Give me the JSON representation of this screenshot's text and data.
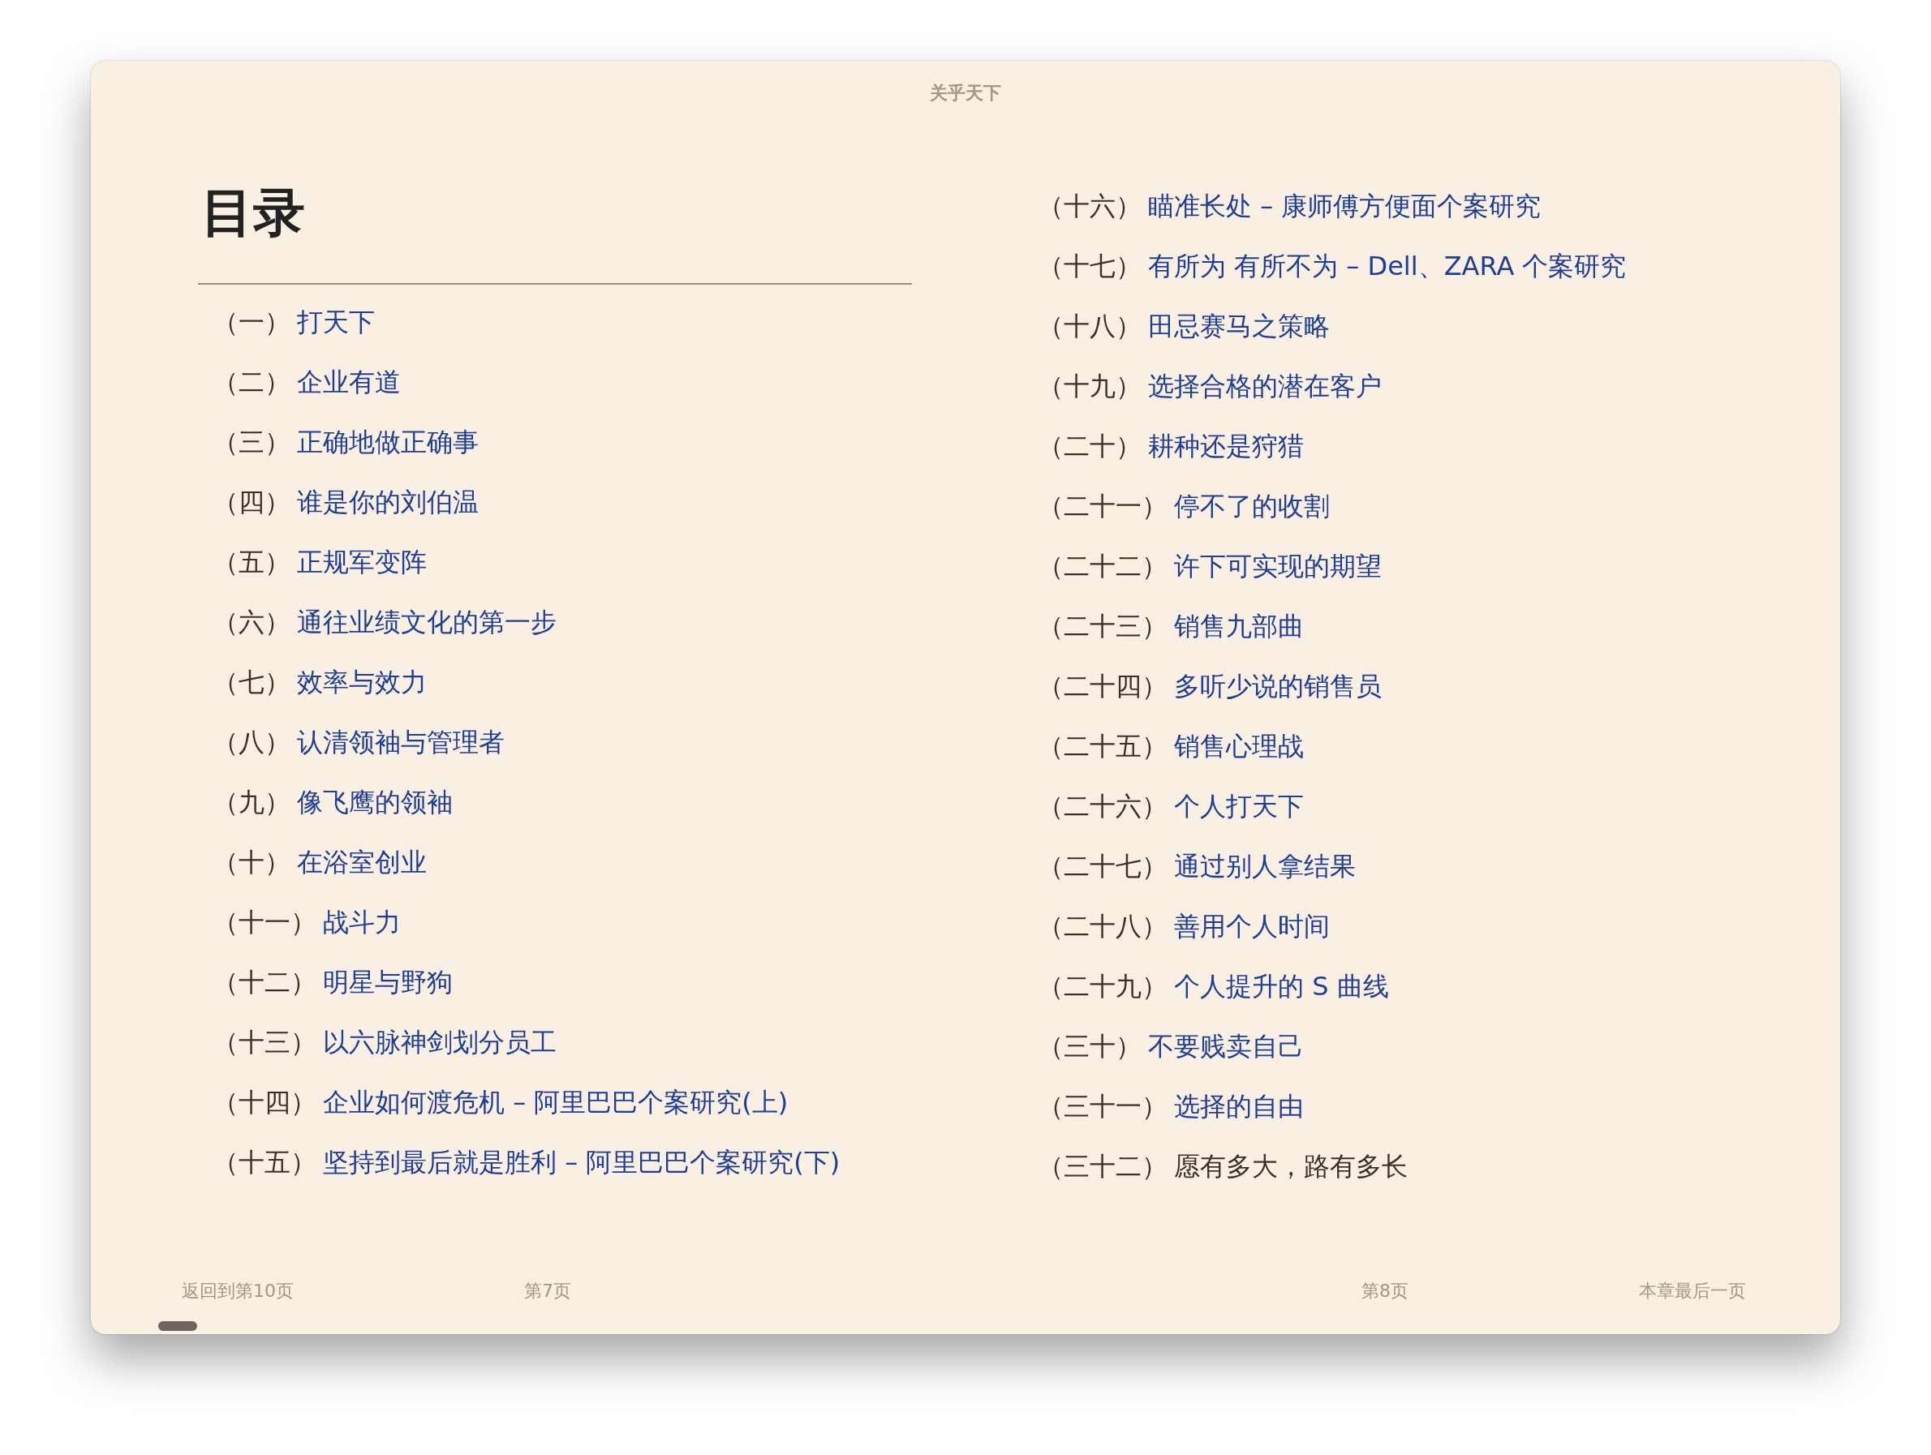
{
  "window": {
    "title": "关乎天下"
  },
  "heading": "目录",
  "columns": [
    {
      "entries": [
        {
          "number": "（一）",
          "title": "打天下",
          "link": true
        },
        {
          "number": "（二）",
          "title": "企业有道",
          "link": true
        },
        {
          "number": "（三）",
          "title": "正确地做正确事",
          "link": true
        },
        {
          "number": "（四）",
          "title": "谁是你的刘伯温",
          "link": true
        },
        {
          "number": "（五）",
          "title": "正规军变阵",
          "link": true
        },
        {
          "number": "（六）",
          "title": "通往业绩文化的第一步",
          "link": true
        },
        {
          "number": "（七）",
          "title": "效率与效力",
          "link": true
        },
        {
          "number": "（八）",
          "title": "认清领袖与管理者",
          "link": true
        },
        {
          "number": "（九）",
          "title": "像飞鹰的领袖",
          "link": true
        },
        {
          "number": "（十）",
          "title": "在浴室创业",
          "link": true
        },
        {
          "number": "（十一）",
          "title": "战斗力",
          "link": true
        },
        {
          "number": "（十二）",
          "title": "明星与野狗",
          "link": true
        },
        {
          "number": "（十三）",
          "title": "以六脉神剑划分员工",
          "link": true
        },
        {
          "number": "（十四）",
          "title": "企业如何渡危机 – 阿里巴巴个案研究(上)",
          "link": true
        },
        {
          "number": "（十五）",
          "title": "坚持到最后就是胜利 – 阿里巴巴个案研究(下)",
          "link": true
        }
      ]
    },
    {
      "entries": [
        {
          "number": "（十六）",
          "title": "瞄准长处 – 康师傅方便面个案研究",
          "link": true
        },
        {
          "number": "（十七）",
          "title": "有所为 有所不为 – Dell、ZARA 个案研究",
          "link": true
        },
        {
          "number": "（十八）",
          "title": "田忌赛马之策略",
          "link": true
        },
        {
          "number": "（十九）",
          "title": "选择合格的潜在客户",
          "link": true
        },
        {
          "number": "（二十）",
          "title": "耕种还是狩猎",
          "link": true
        },
        {
          "number": "（二十一）",
          "title": "停不了的收割",
          "link": true
        },
        {
          "number": "（二十二）",
          "title": "许下可实现的期望",
          "link": true
        },
        {
          "number": "（二十三）",
          "title": "销售九部曲",
          "link": true
        },
        {
          "number": "（二十四）",
          "title": "多听少说的销售员",
          "link": true
        },
        {
          "number": "（二十五）",
          "title": "销售心理战",
          "link": true
        },
        {
          "number": "（二十六）",
          "title": "个人打天下",
          "link": true
        },
        {
          "number": "（二十七）",
          "title": "通过别人拿结果",
          "link": true
        },
        {
          "number": "（二十八）",
          "title": "善用个人时间",
          "link": true
        },
        {
          "number": "（二十九）",
          "title": "个人提升的 S 曲线",
          "link": true
        },
        {
          "number": "（三十）",
          "title": "不要贱卖自己",
          "link": true
        },
        {
          "number": "（三十一）",
          "title": "选择的自由",
          "link": true
        },
        {
          "number": "（三十二）",
          "title": "愿有多大，路有多长",
          "link": false
        }
      ]
    }
  ],
  "footer": {
    "back_link": "返回到第10页",
    "left_page": "第7页",
    "right_page": "第8页",
    "chapter_end_link": "本章最后一页"
  }
}
